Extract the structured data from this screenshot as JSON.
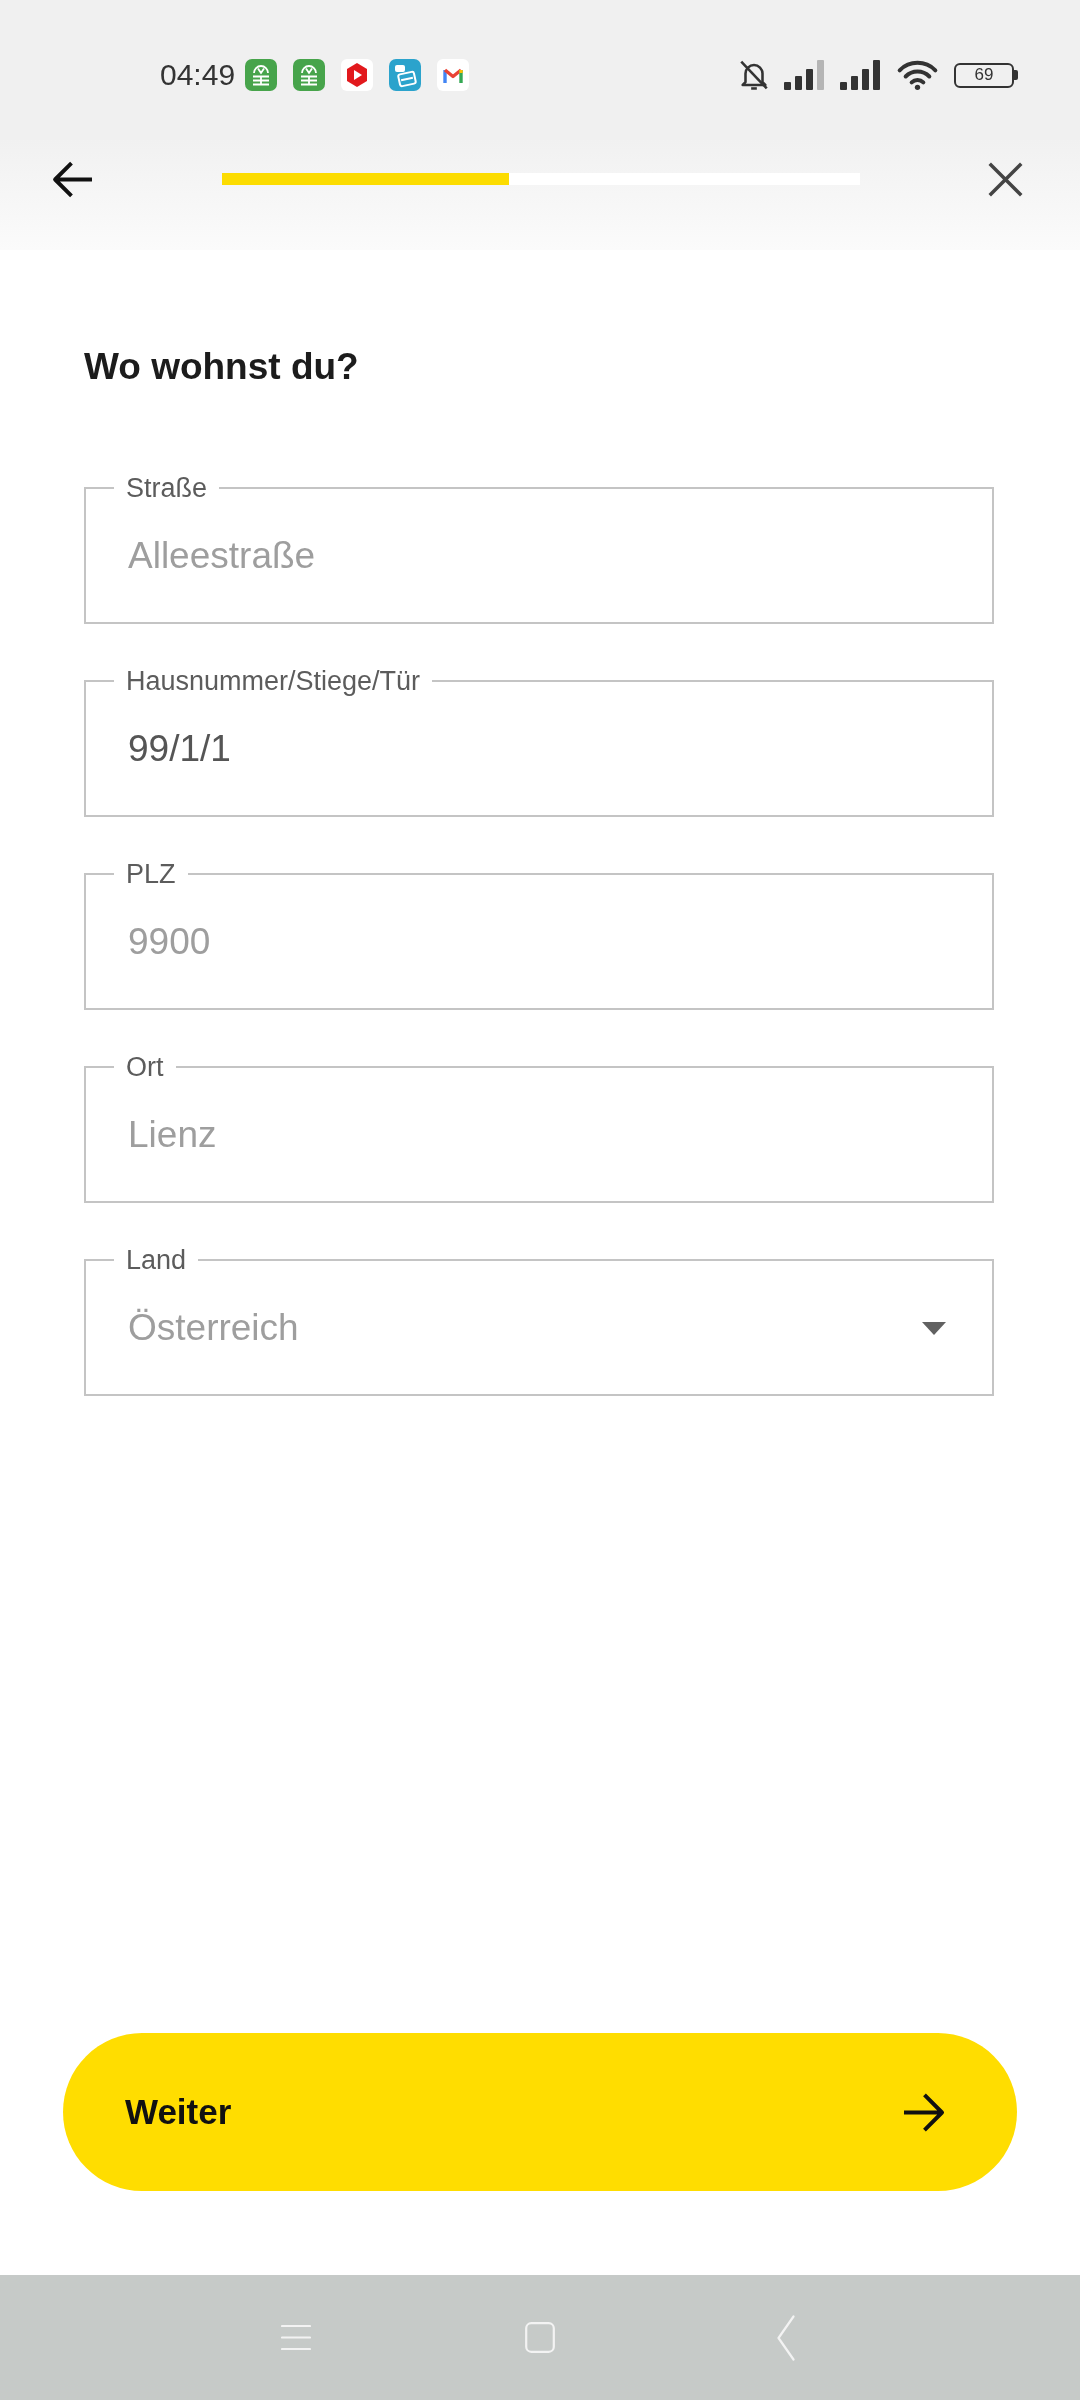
{
  "status_bar": {
    "time": "04:49",
    "battery": "69"
  },
  "header": {
    "progress": {
      "level": 0.45
    }
  },
  "title": "Wo wohnst du?",
  "fields": [
    {
      "kind": "text",
      "label": "Straße",
      "placeholder": "Alleestraße"
    },
    {
      "kind": "text",
      "label": "Hausnummer/Stiege/Tür",
      "value": "99/1/1"
    },
    {
      "kind": "text",
      "label": "PLZ",
      "placeholder": "9900"
    },
    {
      "kind": "text",
      "label": "Ort",
      "placeholder": "Lienz"
    },
    {
      "kind": "select",
      "label": "Land",
      "placeholder": "Österreich"
    }
  ],
  "primary_button": {
    "label": "Weiter"
  }
}
